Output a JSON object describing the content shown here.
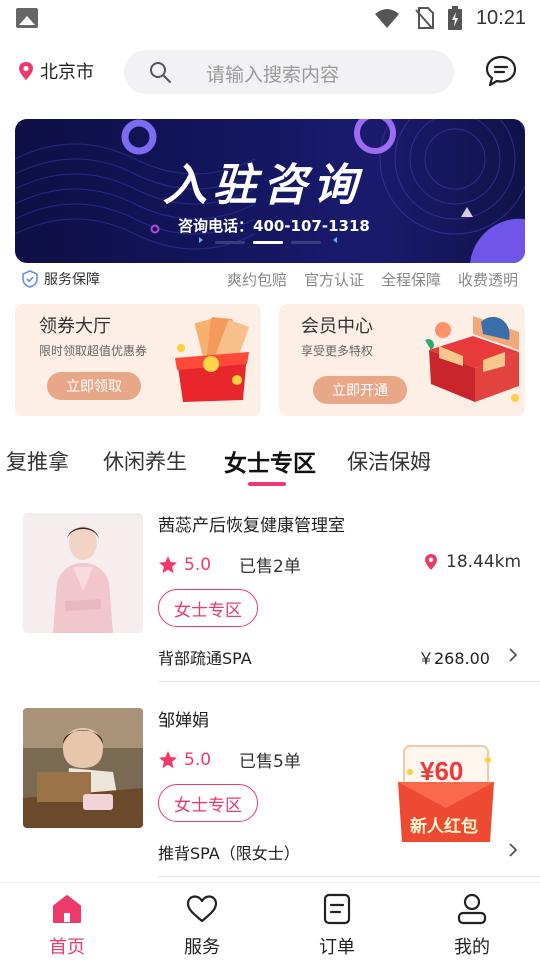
{
  "status_bar": {
    "time": "10:21"
  },
  "header": {
    "city": "北京市",
    "search_placeholder": "请输入搜索内容"
  },
  "banner": {
    "title": "入驻咨询",
    "phone_text": "咨询电话：400-107-1318",
    "slide_count": 3,
    "active_slide": 2
  },
  "guarantee": {
    "label": "服务保障",
    "items": [
      "爽约包赔",
      "官方认证",
      "全程保障",
      "收费透明"
    ]
  },
  "cards": [
    {
      "title": "领券大厅",
      "subtitle": "限时领取超值优惠券",
      "button": "立即领取"
    },
    {
      "title": "会员中心",
      "subtitle": "享受更多特权",
      "button": "立即开通"
    }
  ],
  "tabs": {
    "items": [
      "复推拿",
      "休闲养生",
      "女士专区",
      "保洁保姆"
    ],
    "active": "女士专区"
  },
  "services": [
    {
      "name": "茜蕊产后恢复健康管理室",
      "rating": "5.0",
      "sold": "已售2单",
      "distance": "18.44km",
      "tag": "女士专区",
      "item": "背部疏通SPA",
      "price": "￥268.00"
    },
    {
      "name": "邹婵娟",
      "rating": "5.0",
      "sold": "已售5单",
      "tag": "女士专区",
      "item": "推背SPA（限女士）"
    }
  ],
  "red_packet": {
    "amount": "¥60",
    "label": "新人红包"
  },
  "bottom_nav": [
    {
      "label": "首页",
      "icon": "home-icon",
      "active": true
    },
    {
      "label": "服务",
      "icon": "heart-icon",
      "active": false
    },
    {
      "label": "订单",
      "icon": "order-icon",
      "active": false
    },
    {
      "label": "我的",
      "icon": "user-icon",
      "active": false
    }
  ],
  "colors": {
    "accent": "#ee3a6a",
    "banner_bg": "#141660",
    "card_bg": "#fdeee6",
    "card_button": "#e8a888"
  }
}
